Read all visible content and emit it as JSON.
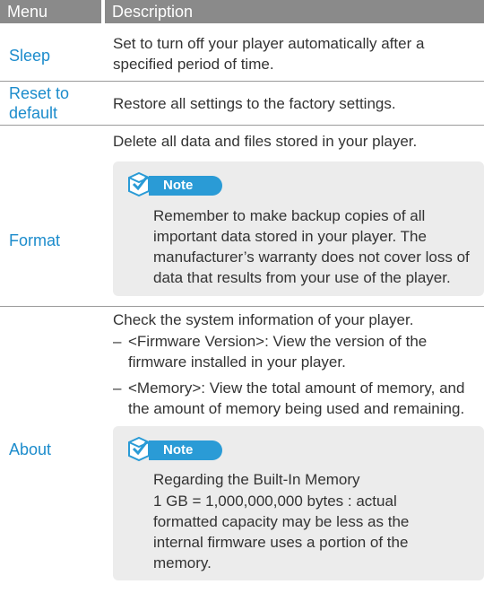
{
  "header": {
    "menu": "Menu",
    "description": "Description"
  },
  "rows": {
    "sleep": {
      "menu": "Sleep",
      "desc": "Set to turn off your player automatically after a specified period of time."
    },
    "reset": {
      "menu_line1": "Reset to",
      "menu_line2": "default",
      "desc": "Restore all settings to the factory settings."
    },
    "format": {
      "menu": "Format",
      "desc": "Delete all data and files stored in your player.",
      "note_label": "Note",
      "note_text": "Remember to make backup copies of all important data stored in your player. The manufacturer’s warranty does not cover loss of data that results from your use of the player."
    },
    "about": {
      "menu": "About",
      "desc": "Check the system information of your player.",
      "bullets": [
        {
          "dash": "–",
          "text": "<Firmware Version>: View the version of the firmware installed in your player."
        },
        {
          "dash": "–",
          "text": "<Memory>: View the total amount of memory, and the amount of memory being used and remaining."
        }
      ],
      "note_label": "Note",
      "note_heading": "Regarding the Built-In Memory",
      "note_text": "1 GB = 1,000,000,000 bytes : actual formatted capacity may be less as the internal firmware uses a portion of the memory."
    }
  },
  "colors": {
    "accent": "#1c8ccc",
    "header_bg": "#8a8a8a",
    "note_bg": "#ececec",
    "note_pill": "#2a9bd6"
  },
  "icons": {
    "note": "note-checkbox-icon"
  }
}
